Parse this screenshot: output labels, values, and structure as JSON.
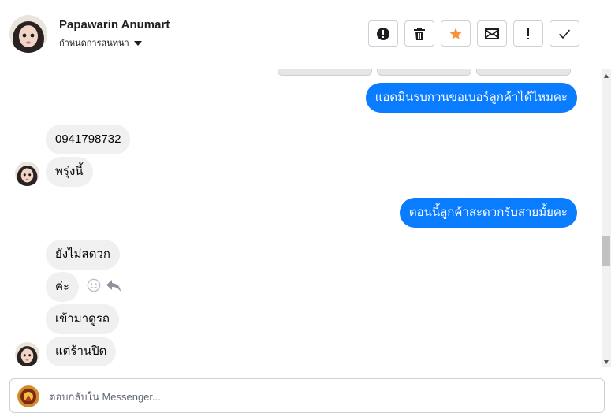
{
  "header": {
    "contact_name": "Papawarin Anumart",
    "subtitle": "กำหนดการสนทนา",
    "toolbar": [
      {
        "name": "report-button",
        "icon": "alert-circle-icon"
      },
      {
        "name": "delete-button",
        "icon": "trash-icon"
      },
      {
        "name": "star-button",
        "icon": "star-icon"
      },
      {
        "name": "mark-unread-button",
        "icon": "envelope-icon"
      },
      {
        "name": "spam-button",
        "icon": "exclamation-icon"
      },
      {
        "name": "done-button",
        "icon": "check-icon"
      }
    ]
  },
  "messages": [
    {
      "side": "out",
      "text": "แอดมินรบกวนขอเบอร์ลูกค้าได้ไหมคะ"
    },
    {
      "side": "in",
      "text": "0941798732"
    },
    {
      "side": "in",
      "text": "พรุ่งนี้"
    },
    {
      "side": "out",
      "text": "ตอนนี้ลูกค้าสะดวกรับสายมั้ยคะ"
    },
    {
      "side": "in",
      "text": "ยังไม่สดวก"
    },
    {
      "side": "in",
      "text": "ค่ะ"
    },
    {
      "side": "in",
      "text": "เข้ามาดูรถ"
    },
    {
      "side": "in",
      "text": "แต่ร้านปิด"
    }
  ],
  "composer": {
    "placeholder": "ตอบกลับใน Messenger..."
  },
  "colors": {
    "outgoing_bubble": "#0a7cff",
    "incoming_bubble": "#f0f0f0",
    "star": "#f7923b"
  }
}
